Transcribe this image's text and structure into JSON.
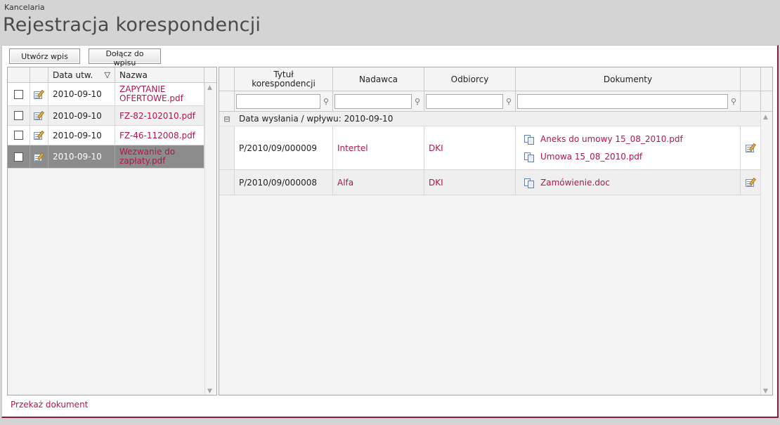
{
  "header": {
    "breadcrumb": "Kancelaria",
    "title": "Rejestracja korespondencji"
  },
  "toolbar": {
    "create_label": "Utwórz wpis",
    "attach_label": "Dołącz do wpisu"
  },
  "left_grid": {
    "col_date": "Data utw.",
    "col_name": "Nazwa",
    "sort_indicator": "▽",
    "rows": [
      {
        "date": "2010-09-10",
        "name": "ZAPYTANIE OFERTOWE.pdf",
        "selected": false
      },
      {
        "date": "2010-09-10",
        "name": "FZ-82-102010.pdf",
        "selected": false
      },
      {
        "date": "2010-09-10",
        "name": "FZ-46-112008.pdf",
        "selected": false
      },
      {
        "date": "2010-09-10",
        "name": "Wezwanie do zapłaty.pdf",
        "selected": true
      }
    ]
  },
  "right_grid": {
    "col_title": "Tytuł korespondencji",
    "col_sender": "Nadawca",
    "col_recipient": "Odbiorcy",
    "col_documents": "Dokumenty",
    "group_label": "Data wysłania / wpływu: 2010-09-10",
    "collapse_symbol": "⊟",
    "rows": [
      {
        "title": "P/2010/09/000009",
        "sender": "Intertel",
        "recipient": "DKI",
        "documents": [
          "Aneks do umowy 15_08_2010.pdf",
          "Umowa 15_08_2010.pdf"
        ]
      },
      {
        "title": "P/2010/09/000008",
        "sender": "Alfa",
        "recipient": "DKI",
        "documents": [
          "Zamówienie.doc"
        ]
      }
    ]
  },
  "footer": {
    "forward_label": "Przekaż dokument"
  },
  "colors": {
    "accent": "#b0164c",
    "selected_row": "#8c8c8c",
    "border": "#8a1a48"
  }
}
